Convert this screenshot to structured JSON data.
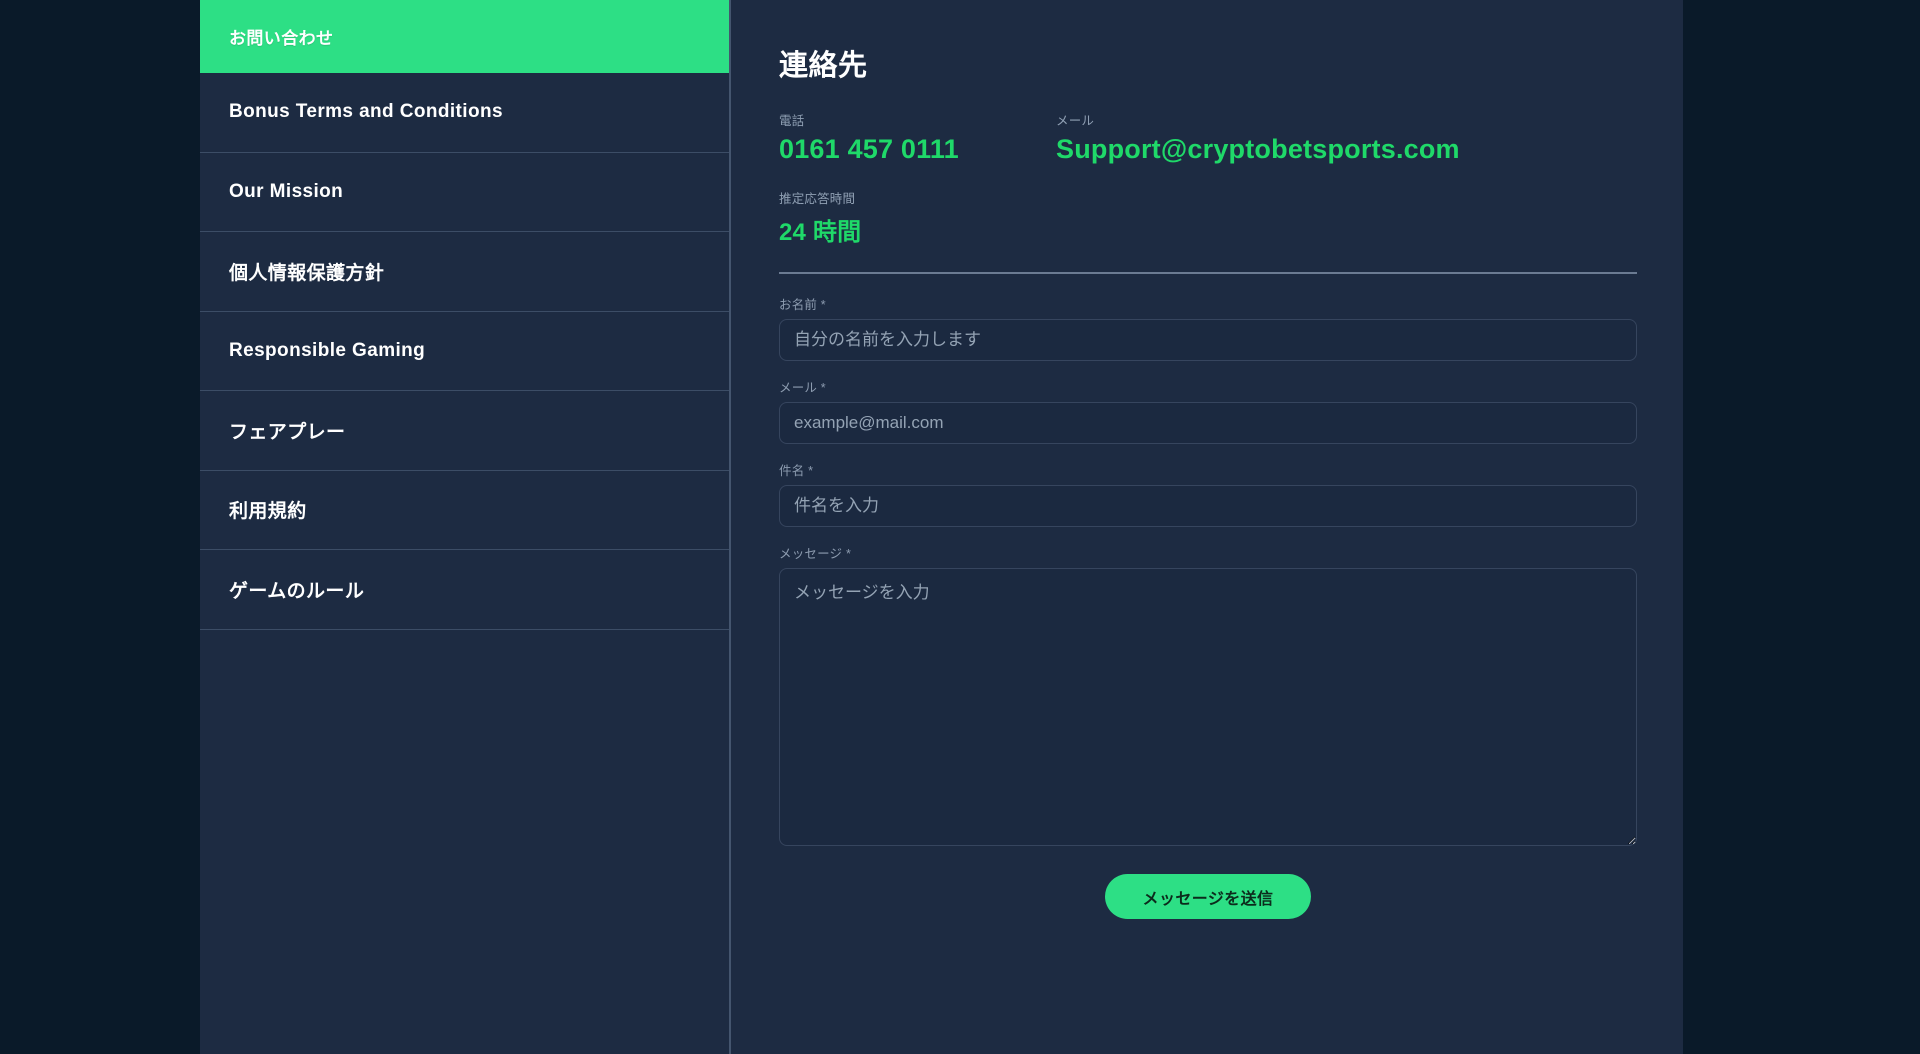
{
  "sidebar": {
    "items": [
      {
        "label": "お問い合わせ",
        "active": true
      },
      {
        "label": "Bonus Terms and Conditions",
        "active": false
      },
      {
        "label": "Our Mission",
        "active": false
      },
      {
        "label": "個人情報保護方針",
        "active": false
      },
      {
        "label": "Responsible Gaming",
        "active": false
      },
      {
        "label": "フェアプレー",
        "active": false
      },
      {
        "label": "利用規約",
        "active": false
      },
      {
        "label": "ゲームのルール",
        "active": false
      }
    ]
  },
  "main": {
    "title": "連絡先",
    "contact": {
      "phone_label": "電話",
      "phone_value": "0161 457 0111",
      "email_label": "メール",
      "email_value": "Support@cryptobetsports.com",
      "hours_label": "推定応答時間",
      "hours_value": "24 時間"
    },
    "form": {
      "name": {
        "label": "お名前",
        "required_mark": "*",
        "placeholder": "自分の名前を入力します",
        "value": ""
      },
      "email": {
        "label": "メール",
        "required_mark": "*",
        "placeholder": "example@mail.com",
        "value": ""
      },
      "subject": {
        "label": "件名",
        "required_mark": "*",
        "placeholder": "件名を入力",
        "value": ""
      },
      "message": {
        "label": "メッセージ",
        "required_mark": "*",
        "placeholder": "メッセージを入力",
        "value": ""
      },
      "submit_label": "メッセージを送信"
    }
  },
  "colors": {
    "accent_green": "#2ddf85",
    "value_green": "#1fd969",
    "panel_bg": "#1d2b42",
    "page_bg": "#0a1a29",
    "divider": "#3c4d66"
  }
}
